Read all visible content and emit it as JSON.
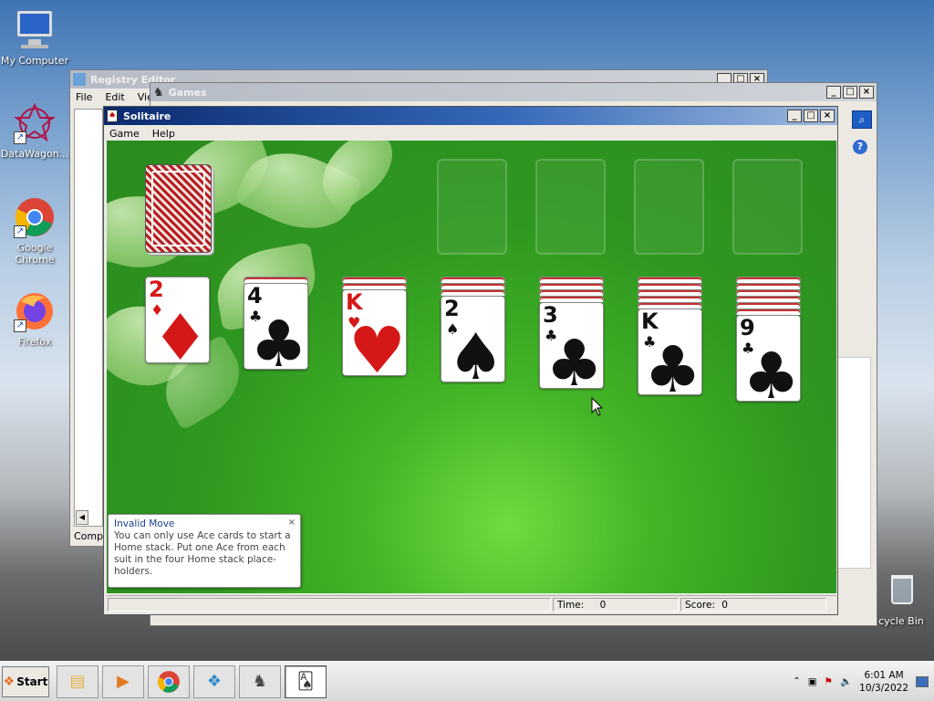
{
  "desktop": {
    "icons": [
      {
        "label": "My Computer",
        "icon": "my-computer-icon"
      },
      {
        "label": "DataWagon...",
        "icon": "datawagon-icon"
      },
      {
        "label": "Google Chrome",
        "icon": "chrome-icon"
      },
      {
        "label": "Firefox",
        "icon": "firefox-icon"
      },
      {
        "label": "cycle Bin",
        "icon": "recycle-bin-icon"
      }
    ]
  },
  "registry": {
    "title": "Registry Editor",
    "menu": [
      "File",
      "Edit",
      "View"
    ],
    "status": "Compu"
  },
  "games": {
    "title": "Games"
  },
  "solitaire": {
    "title": "Solitaire",
    "menu": [
      "Game",
      "Help"
    ],
    "time_label": "Time:",
    "time_value": "0",
    "score_label": "Score:",
    "score_value": "0",
    "tableau": [
      {
        "rank": "2",
        "suit": "♦",
        "color": "red",
        "hidden": 0
      },
      {
        "rank": "4",
        "suit": "♣",
        "color": "black",
        "hidden": 1
      },
      {
        "rank": "K",
        "suit": "♥",
        "color": "red",
        "hidden": 2
      },
      {
        "rank": "2",
        "suit": "♠",
        "color": "black",
        "hidden": 3
      },
      {
        "rank": "3",
        "suit": "♣",
        "color": "black",
        "hidden": 4
      },
      {
        "rank": "K",
        "suit": "♣",
        "color": "black",
        "hidden": 5
      },
      {
        "rank": "9",
        "suit": "♣",
        "color": "black",
        "hidden": 6
      }
    ],
    "tooltip": {
      "title": "Invalid Move",
      "body": "You can only use Ace cards to start a Home stack. Put one Ace from each suit in the four Home stack place-holders.",
      "close": "×"
    }
  },
  "taskbar": {
    "start_label": "Start",
    "apps": [
      "explorer-icon",
      "media-player-icon",
      "chrome-icon",
      "registry-icon",
      "chess-icon",
      "solitaire-icon"
    ],
    "time": "6:01 AM",
    "date": "10/3/2022"
  },
  "colors": {
    "felt": "#2f9820",
    "title_active": "#0a2a6e",
    "card_red": "#d41818"
  }
}
